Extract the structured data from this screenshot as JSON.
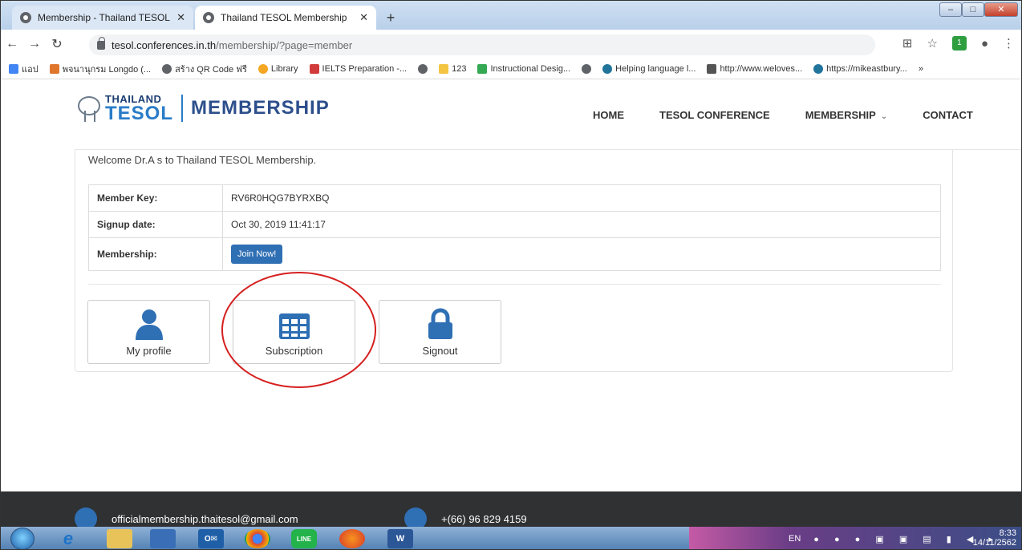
{
  "browser": {
    "tabs": [
      {
        "title": "Membership - Thailand TESOL An",
        "active": false
      },
      {
        "title": "Thailand TESOL Membership",
        "active": true
      }
    ],
    "new_tab": "+",
    "url_host": "tesol.conferences.in.th",
    "url_path": "/membership/?page=member",
    "bookmarks": [
      "แอป",
      "พจนานุกรม Longdo (...",
      "สร้าง QR Code ฟรี",
      "Library",
      "IELTS Preparation -...",
      "123",
      "Instructional Desig...",
      "Helping language l...",
      "http://www.weloves...",
      "https://mikeastbury..."
    ],
    "bookmarks_more": "»"
  },
  "site": {
    "logo_top": "THAILAND",
    "logo_bottom": "TESOL",
    "logo_section": "MEMBERSHIP",
    "nav": [
      "HOME",
      "TESOL CONFERENCE",
      "MEMBERSHIP",
      "CONTACT"
    ]
  },
  "member": {
    "welcome": "Welcome Dr.A s to Thailand TESOL Membership.",
    "rows": [
      {
        "label": "Member Key:",
        "value": "RV6R0HQG7BYRXBQ"
      },
      {
        "label": "Signup date:",
        "value": "Oct 30, 2019 11:41:17"
      },
      {
        "label": "Membership:",
        "value": ""
      }
    ],
    "join_label": "Join Now!"
  },
  "tiles": [
    {
      "label": "My profile",
      "icon": "user-icon"
    },
    {
      "label": "Subscription",
      "icon": "grid-icon"
    },
    {
      "label": "Signout",
      "icon": "lock-icon"
    }
  ],
  "footer": {
    "email": "officialmembership.thaitesol@gmail.com",
    "phone": "+(66) 96 829 4159"
  },
  "taskbar": {
    "lang": "EN",
    "time": "8:33",
    "date": "14/11/2562"
  },
  "colors": {
    "accent": "#2f6fb4",
    "logo_blue": "#2a7cc7",
    "highlight_circle": "#d61f1f"
  }
}
